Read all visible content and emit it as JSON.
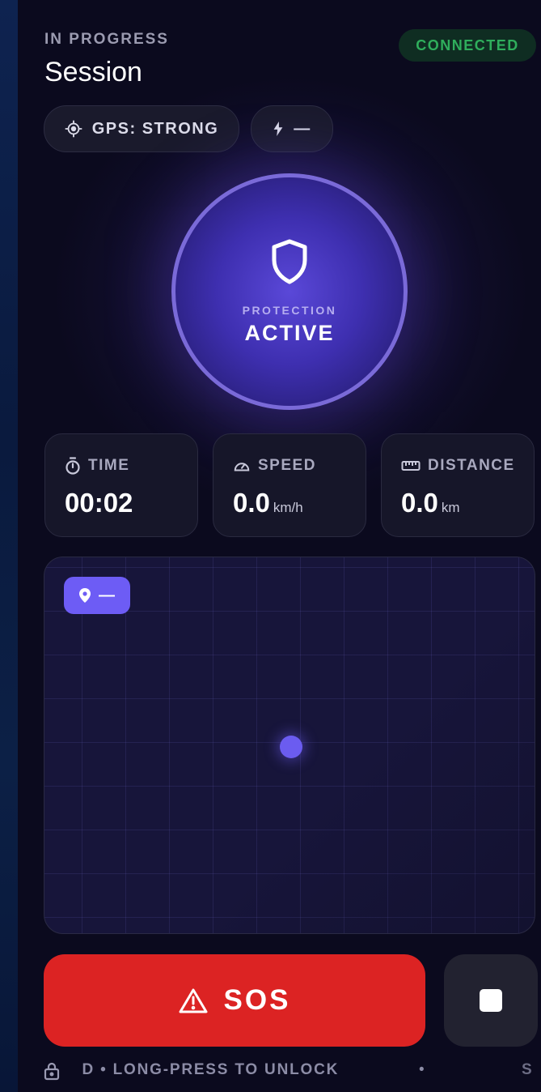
{
  "header": {
    "status_label": "IN PROGRESS",
    "title": "Session",
    "connection_badge": "CONNECTED"
  },
  "indicators": {
    "gps_label": "GPS: STRONG",
    "power_label": "—"
  },
  "protection": {
    "label": "PROTECTION",
    "status": "ACTIVE"
  },
  "stats": {
    "time": {
      "label": "TIME",
      "value": "00:02"
    },
    "speed": {
      "label": "SPEED",
      "value": "0.0",
      "unit": "km/h"
    },
    "distance": {
      "label": "DISTANCE",
      "value": "0.0",
      "unit": "km"
    }
  },
  "map": {
    "location_label": "—"
  },
  "actions": {
    "sos_label": "SOS"
  },
  "lock_banner": {
    "text": "LOCKED • LONG-PRESS TO UNLOCK",
    "separator": "•",
    "text_repeat": "S"
  },
  "colors": {
    "accent": "#6d5cf5",
    "sos": "#dc2323",
    "connected": "#2fae5c",
    "background": "#0b0a1e"
  },
  "icons": [
    "crosshair-icon",
    "bolt-icon",
    "shield-icon",
    "stopwatch-icon",
    "speedometer-icon",
    "ruler-icon",
    "map-pin-icon",
    "warning-icon",
    "stop-icon",
    "lock-icon"
  ]
}
